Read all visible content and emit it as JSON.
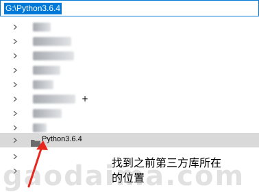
{
  "address_bar": {
    "path": "G:\\Python3.6.4"
  },
  "tree": {
    "selected_label": "Python3.6.4"
  },
  "annotation": {
    "line1": "找到之前第三方库所在",
    "line2": "的位置",
    "arrow_color": "#e8261b"
  },
  "watermark": "gaodaima.com",
  "colors": {
    "selection": "#0078d7",
    "row_highlight": "#d9d9d9"
  }
}
